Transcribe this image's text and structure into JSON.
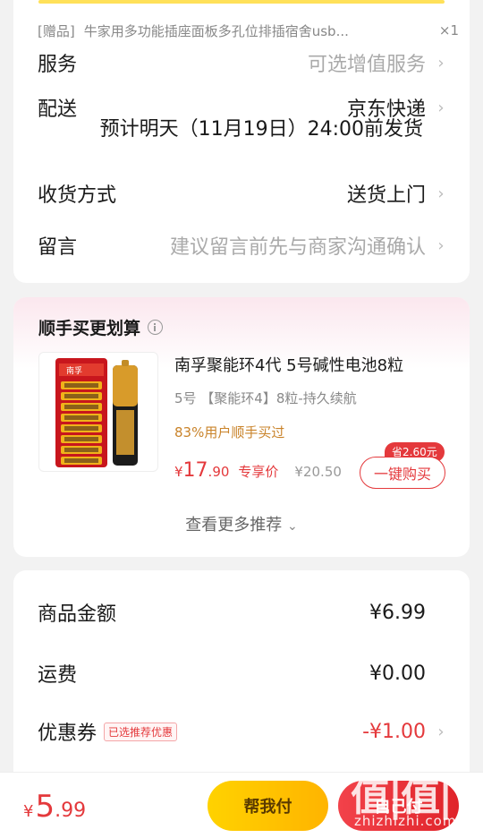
{
  "gift": {
    "tag": "[赠品]",
    "title": "牛家用多功能插座面板多孔位排插宿舍usb...",
    "qty": "×1"
  },
  "order_rows": [
    {
      "label": "服务",
      "value": "可选增值服务"
    },
    {
      "label": "配送",
      "value": "京东快递"
    },
    {
      "label": "收货方式",
      "value": "送货上门"
    },
    {
      "label": "留言",
      "value": "建议留言前先与商家沟通确认"
    }
  ],
  "delivery_eta": "预计明天（11月19日）24:00前发货",
  "recommend": {
    "title": "顺手买更划算",
    "product": {
      "title": "南孚聚能环4代 5号碱性电池8粒",
      "spec": "5号   【聚能环4】8粒-持久续航",
      "social": "83%用户顺手买过",
      "price_currency": "¥",
      "price_int": "17",
      "price_dec": ".90",
      "price_tag": "专享价",
      "price_original": "¥20.50",
      "save_badge": "省2.60元",
      "buy_label": "一键购买",
      "image_text": "南孚"
    },
    "more_label": "查看更多推荐"
  },
  "amounts": [
    {
      "label": "商品金额",
      "value": "¥6.99"
    },
    {
      "label": "运费",
      "value": "¥0.00"
    },
    {
      "label": "优惠券",
      "badge": "已选推荐优惠",
      "value": "-¥1.00"
    }
  ],
  "bottom": {
    "total_currency": "¥",
    "total_int": "5",
    "total_dec": ".99",
    "help_pay": "帮我付",
    "self_pay": "自己付"
  },
  "watermark": {
    "big": "值|值|值",
    "small": "zhizhizhi.com"
  },
  "colors": {
    "accent_red": "#e4393c",
    "accent_yellow": "#ffd200",
    "social_orange": "#c9832a"
  },
  "icons": [
    "chevron-right-icon",
    "info-icon",
    "chevron-down-icon"
  ]
}
